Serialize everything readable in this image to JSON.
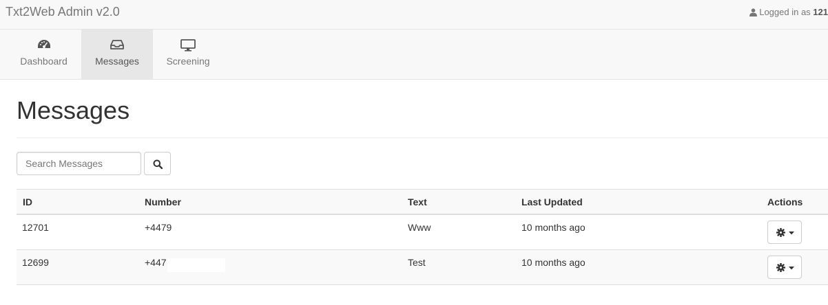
{
  "app": {
    "title": "Txt2Web Admin v2.0",
    "user_prefix": "Logged in as",
    "user_name": "121"
  },
  "nav": {
    "items": [
      {
        "label": "Dashboard",
        "icon": "dashboard-icon",
        "active": false
      },
      {
        "label": "Messages",
        "icon": "inbox-icon",
        "active": true
      },
      {
        "label": "Screening",
        "icon": "monitor-icon",
        "active": false
      }
    ]
  },
  "page": {
    "title": "Messages"
  },
  "search": {
    "placeholder": "Search Messages",
    "value": "",
    "button_icon": "search-icon"
  },
  "table": {
    "columns": [
      "ID",
      "Number",
      "Text",
      "Last Updated",
      "Actions"
    ],
    "rows": [
      {
        "id": "12701",
        "number": "+4479",
        "text": "Www",
        "updated": "10 months ago",
        "action_icon": "gear-icon"
      },
      {
        "id": "12699",
        "number": "+447",
        "text": "Test",
        "updated": "10 months ago",
        "action_icon": "gear-icon"
      }
    ]
  },
  "colors": {
    "bar_bg": "#f8f8f8",
    "active_tab_bg": "#e7e7e7",
    "text": "#333333",
    "muted": "#777777",
    "border": "#dddddd"
  }
}
